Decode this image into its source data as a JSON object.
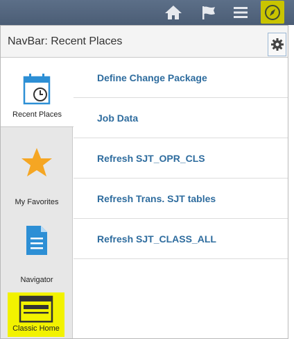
{
  "header": {
    "nav_icons": [
      "home-icon",
      "flag-icon",
      "menu-icon",
      "compass-icon"
    ],
    "active_color": "#c9c400"
  },
  "panel": {
    "title": "NavBar: Recent Places"
  },
  "tabs": [
    {
      "label": "Recent Places",
      "icon": "calendar-clock-icon",
      "selected": true
    },
    {
      "label": "My Favorites",
      "icon": "star-icon",
      "selected": false
    },
    {
      "label": "Navigator",
      "icon": "document-icon",
      "selected": false
    },
    {
      "label": "Classic Home",
      "icon": "window-icon",
      "selected": false,
      "highlight": "#f2f200"
    }
  ],
  "recent_places": [
    {
      "label": "Define Change Package"
    },
    {
      "label": "Job Data"
    },
    {
      "label": "Refresh SJT_OPR_CLS"
    },
    {
      "label": "Refresh Trans. SJT tables"
    },
    {
      "label": "Refresh SJT_CLASS_ALL"
    }
  ]
}
